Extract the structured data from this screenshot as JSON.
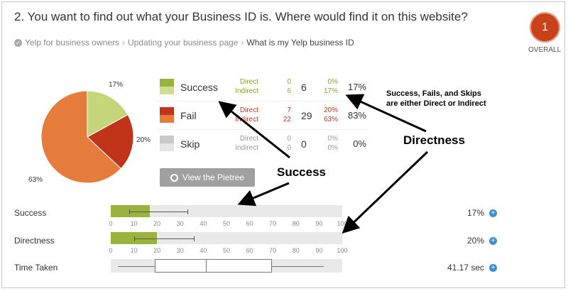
{
  "question": {
    "title": "2. You want to find out what your Business ID is. Where would find it on this website?"
  },
  "breadcrumb": {
    "items": [
      "Yelp for business owners",
      "Updating your business page",
      "What is my Yelp business ID"
    ],
    "separator": "›"
  },
  "overall": {
    "rank": "1",
    "label": "OVERALL"
  },
  "pie": {
    "labels": [
      "17%",
      "20%",
      "63%"
    ],
    "slices": [
      {
        "name": "Success",
        "value": 17,
        "color": "#c5d67a"
      },
      {
        "name": "Fail",
        "value": 20,
        "color": "#c0341a"
      },
      {
        "name": "Fail",
        "value": 63,
        "color": "#e57c3c"
      }
    ]
  },
  "results": {
    "rows": [
      {
        "name": "Success",
        "top_color": "#9ab33c",
        "bottom_color": "#cfdd8e",
        "label_color": "#8aa52d",
        "direct_label": "Direct",
        "indirect_label": "Indirect",
        "direct_count": "0",
        "indirect_count": "6",
        "total": "6",
        "direct_pct": "0%",
        "indirect_pct": "17%",
        "row_pct": "17%"
      },
      {
        "name": "Fail",
        "top_color": "#c0341a",
        "bottom_color": "#e57c3c",
        "label_color": "#c0392b",
        "direct_label": "Direct",
        "indirect_label": "Indirect",
        "direct_count": "7",
        "indirect_count": "22",
        "total": "29",
        "direct_pct": "20%",
        "indirect_pct": "63%",
        "row_pct": "83%"
      },
      {
        "name": "Skip",
        "top_color": "#c9c9c9",
        "bottom_color": "#e4e4e4",
        "label_color": "#999999",
        "direct_label": "Direct",
        "indirect_label": "Indirect",
        "direct_count": "0",
        "indirect_count": "0",
        "total": "0",
        "direct_pct": "0%",
        "indirect_pct": "0%",
        "row_pct": "0%"
      }
    ]
  },
  "pietree_button": {
    "label": "View the Pietree",
    "icon": "pie-chart-icon"
  },
  "metrics": [
    {
      "label": "Success",
      "value": "17%",
      "bar_pct": 17,
      "whisker_low": 8,
      "whisker_high": 33,
      "bar_color": "#9ab33c"
    },
    {
      "label": "Directness",
      "value": "20%",
      "bar_pct": 20,
      "whisker_low": 10,
      "whisker_high": 36,
      "bar_color": "#9ab33c"
    },
    {
      "label": "Time Taken",
      "value": "41.17 sec",
      "box_low": 19,
      "box_high": 69,
      "median": 41,
      "whisker_low": 3,
      "whisker_high": 92
    }
  ],
  "axis_ticks": [
    "0",
    "10",
    "20",
    "30",
    "40",
    "50",
    "60",
    "70",
    "80",
    "90",
    "100"
  ],
  "annotations": {
    "success_fails": "Success, Fails, and Skips",
    "direct_indirect": "are either Direct or Indirect",
    "directness": "Directness",
    "success": "Success"
  }
}
